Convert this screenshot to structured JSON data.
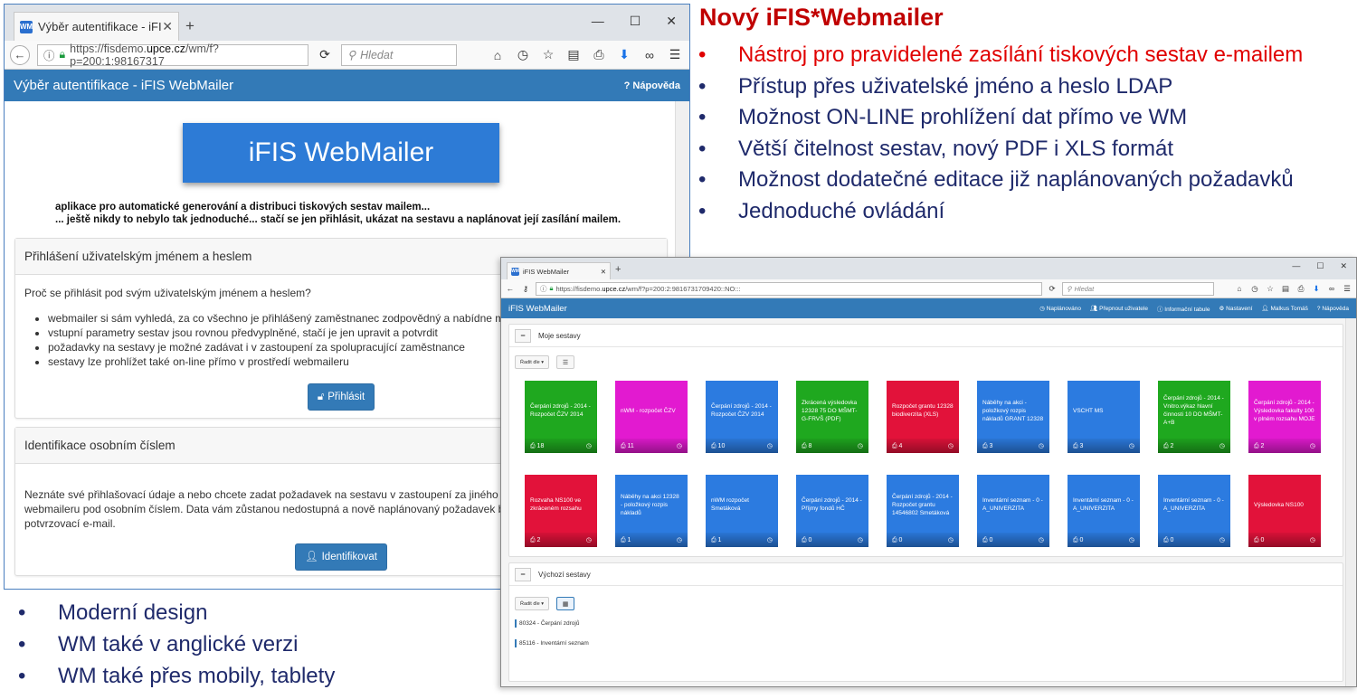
{
  "slide": {
    "title": "Nový iFIS*Webmailer",
    "top_bullets": [
      "Nástroj pro pravidelené zasílání tiskových sestav e-mailem",
      "Přístup přes uživatelské jméno a heslo LDAP",
      "Možnost ON-LINE prohlížení dat přímo ve WM",
      "Větší čitelnost sestav, nový PDF i XLS formát",
      "Možnost dodatečné editace již naplánovaných požadavků",
      "Jednoduché ovládání"
    ],
    "bottom_bullets": [
      "Moderní design",
      "WM také v anglické verzi",
      "WM také přes mobily, tablety"
    ],
    "colors": {
      "title": "#c00000",
      "first_bullet": "#e00000",
      "bullets": "#1f2a6b"
    }
  },
  "login_window": {
    "tab_title": "Výběr autentifikace - iFIS ...",
    "favicon": "WM",
    "url_prefix": "https://fisdemo.",
    "url_host": "upce.cz",
    "url_suffix": "/wm/f?p=200:1:98167317",
    "search_placeholder": "Hledat",
    "header_title": "Výběr autentifikace - iFIS WebMailer",
    "help_label": "Nápověda",
    "logo_text": "iFIS WebMailer",
    "intro_line1": "aplikace pro automatické generování a distribuci tiskových sestav mailem...",
    "intro_line2": "... ještě nikdy to nebylo tak jednoduché... stačí se jen přihlásit, ukázat na sestavu a naplánovat její zasílání mailem.",
    "panel_login": {
      "title": "Přihlášení uživatelským jménem a heslem",
      "question": "Proč se přihlásit pod svým uživatelským jménem a heslem?",
      "items": [
        "webmailer si sám vyhledá, za co všechno je přihlášený zaměstnanec zodpovědný a nabídne mu odp",
        "vstupní parametry sestav jsou rovnou předvyplněné, stačí je jen upravit a potvrdit",
        "požadavky na sestavy je možné zadávat i v zastoupení za spolupracující zaměstnance",
        "sestavy lze prohlížet také on-line přímo v prostředí webmaileru"
      ],
      "button": "Přihlásit"
    },
    "panel_id": {
      "title": "Identifikace osobním číslem",
      "text1": "Neznáte své přihlašovací údaje a nebo chcete zadat požadavek na sestavu v zastoupení za jiného zaměs",
      "text2": "webmaileru pod osobním číslem. Data vám zůstanou nedostupná a nově naplánovaný požadavek bude",
      "text3": "potvrzovací e-mail.",
      "button": "Identifikovat"
    }
  },
  "app_window": {
    "tab_title": "iFIS WebMailer",
    "favicon": "WM",
    "url_prefix": "https://fisdemo.",
    "url_host": "upce.cz",
    "url_suffix": "/wm/f?p=200:2:9816731709420::NO:::",
    "search_placeholder": "Hledat",
    "brand": "iFIS WebMailer",
    "menu": [
      "Naplánováno",
      "Přepnout uživatele",
      "Informační tabule",
      "Nastavení",
      "Malkus Tomáš",
      "Nápověda"
    ],
    "section1_title": "Moje sestavy",
    "section2_title": "Výchozí sestavy",
    "sort_label": "Řadit dle",
    "tiles": [
      {
        "label": "Čerpání zdrojů - 2014 - Rozpočet ČZV 2014",
        "count": "18",
        "color": "#1fa81f"
      },
      {
        "label": "nWM - rozpočet ČZV",
        "count": "11",
        "color": "#e21ad0"
      },
      {
        "label": "Čerpání zdrojů - 2014 - Rozpočet ČZV 2014",
        "count": "10",
        "color": "#2c7be0"
      },
      {
        "label": "Zkrácená výsledovka 12328 75 DO MŠMT-G-FRVŠ (PDF)",
        "count": "8",
        "color": "#1fa81f"
      },
      {
        "label": "Rozpočet grantu 12328 biodiverzita (XLS)",
        "count": "4",
        "color": "#e2123a"
      },
      {
        "label": "Náběhy na akci - položkový rozpis nákladů GRANT 12328",
        "count": "3",
        "color": "#2c7be0"
      },
      {
        "label": "VSCHT MS",
        "count": "3",
        "color": "#2c7be0"
      },
      {
        "label": "Čerpání zdrojů - 2014 - Vnitro.výkaz hlavní činnosti 10 DO MŠMT- A+B",
        "count": "2",
        "color": "#1fa81f"
      },
      {
        "label": "Čerpání zdrojů - 2014 - Výsledovka fakulty 100 v plném rozsahu MOJE",
        "count": "2",
        "color": "#e21ad0"
      },
      {
        "label": "Rozvaha NS100 ve zkráceném rozsahu",
        "count": "2",
        "color": "#e2123a"
      },
      {
        "label": "Náběhy na akci 12328 - položkový rozpis nákladů",
        "count": "1",
        "color": "#2c7be0"
      },
      {
        "label": "nWM rozpočet Smetáková",
        "count": "1",
        "color": "#2c7be0"
      },
      {
        "label": "Čerpání zdrojů - 2014 - Příjmy fondů HČ",
        "count": "0",
        "color": "#2c7be0"
      },
      {
        "label": "Čerpání zdrojů - 2014 - Rozpočet grantu 14546802 Smetáková",
        "count": "0",
        "color": "#2c7be0"
      },
      {
        "label": "Inventární seznam - 0 - A_UNIVERZITA",
        "count": "0",
        "color": "#2c7be0"
      },
      {
        "label": "Inventární seznam - 0 - A_UNIVERZITA",
        "count": "0",
        "color": "#2c7be0"
      },
      {
        "label": "Inventární seznam - 0 - A_UNIVERZITA",
        "count": "0",
        "color": "#2c7be0"
      },
      {
        "label": "Výsledovka NS100",
        "count": "0",
        "color": "#e2123a"
      }
    ],
    "default_reports": [
      "80324 - Čerpání zdrojů",
      "85116 - Inventární seznam"
    ]
  }
}
